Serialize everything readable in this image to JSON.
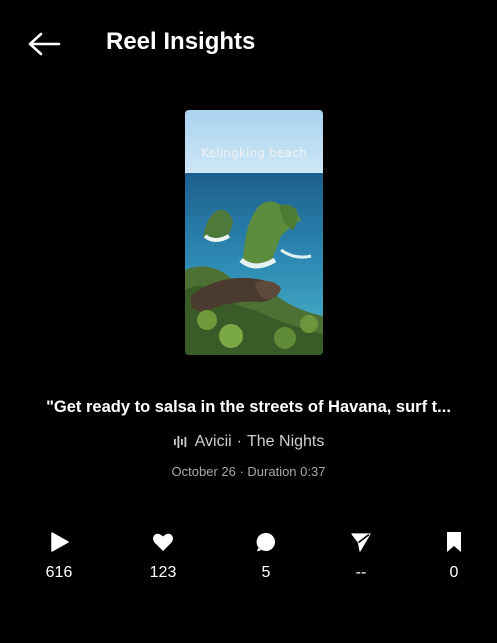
{
  "header": {
    "title": "Reel Insights",
    "back_icon": "arrow-left-icon"
  },
  "reel": {
    "thumbnail_caption": "Kelingking beach",
    "caption": "\"Get ready to salsa in the streets of Havana, surf t...",
    "audio": {
      "icon": "audio-wave-icon",
      "artist": "Avicii",
      "separator": "·",
      "track": "The Nights"
    },
    "meta": "October 26 · Duration 0:37"
  },
  "stats": [
    {
      "icon": "play-icon",
      "value": "616"
    },
    {
      "icon": "heart-icon",
      "value": "123"
    },
    {
      "icon": "comment-icon",
      "value": "5"
    },
    {
      "icon": "share-icon",
      "value": "--"
    },
    {
      "icon": "bookmark-icon",
      "value": "0"
    }
  ],
  "colors": {
    "background": "#000000",
    "text_primary": "#ffffff",
    "text_secondary": "#a8a8a8"
  }
}
